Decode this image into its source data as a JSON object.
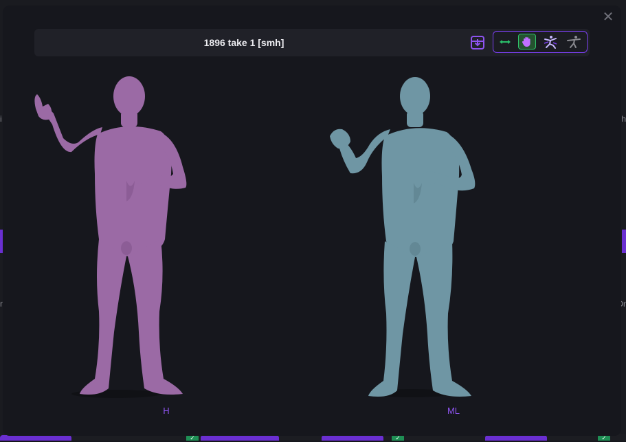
{
  "modal": {
    "title": "1896 take 1 [smh]",
    "close_label": "✕"
  },
  "toolbar": {
    "save_icon": "download-tray-icon",
    "modes": [
      {
        "name": "retarget-arrows-icon",
        "active": false,
        "color": "#2bbf6a"
      },
      {
        "name": "hand-icon",
        "active": true,
        "color": "#c070ff"
      },
      {
        "name": "dance-figure-icon",
        "active": false,
        "color": "#c7b8ff"
      },
      {
        "name": "airplane-figure-icon",
        "active": false,
        "color": "#8a8a90"
      }
    ]
  },
  "figures": [
    {
      "label": "H",
      "color": "#9b6aa5"
    },
    {
      "label": "ML",
      "color": "#6f96a4"
    }
  ],
  "background": {
    "left_text": "i",
    "right_text": "h",
    "left_text_2": "r",
    "right_text_2": "Dr"
  }
}
